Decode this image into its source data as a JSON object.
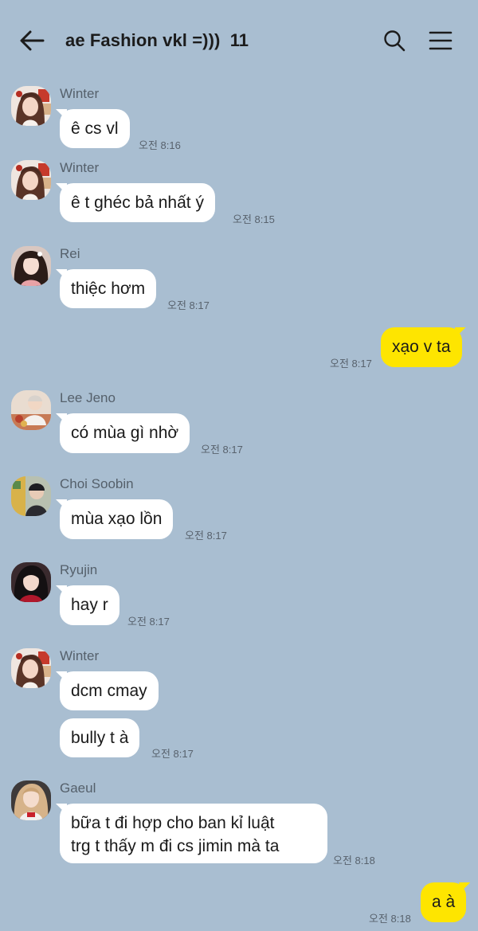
{
  "header": {
    "title": "ae Fashion vkl =)))",
    "member_count": "11",
    "back_icon": "arrow-left-icon",
    "search_icon": "search-icon",
    "menu_icon": "hamburger-menu-icon"
  },
  "colors": {
    "background": "#a9bed1",
    "incoming_bubble": "#ffffff",
    "outgoing_bubble": "#fee500"
  },
  "messages": [
    {
      "sender": "Winter",
      "text": "ê cs vl",
      "time": "오전 8:16"
    },
    {
      "sender": "Winter",
      "text": "ê t ghéc bả nhất ý",
      "time": "오전 8:15"
    },
    {
      "sender": "Rei",
      "text": "thiệc hơm",
      "time": "오전 8:17"
    },
    {
      "sender": "me",
      "text": "xạo v ta",
      "time": "오전 8:17"
    },
    {
      "sender": "Lee Jeno",
      "text": "có mùa gì nhờ",
      "time": "오전 8:17"
    },
    {
      "sender": "Choi Soobin",
      "text": "mùa xạo lồn",
      "time": "오전 8:17"
    },
    {
      "sender": "Ryujin",
      "text": "hay r",
      "time": "오전 8:17"
    },
    {
      "sender": "Winter",
      "text": "dcm cmay",
      "time": ""
    },
    {
      "sender": "Winter",
      "text": "bully t à",
      "time": "오전 8:17"
    },
    {
      "sender": "Gaeul",
      "lines": [
        "bữa t đi hợp cho ban kỉ luật",
        "trg t thấy m đi cs jimin mà ta"
      ],
      "time": "오전 8:18"
    },
    {
      "sender": "me",
      "text": "a à",
      "time": "오전 8:18"
    }
  ]
}
